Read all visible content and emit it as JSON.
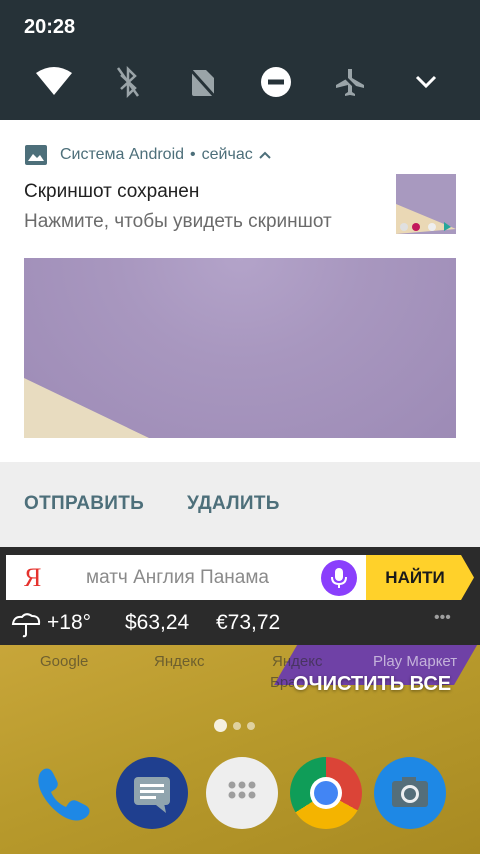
{
  "status": {
    "time": "20:28"
  },
  "quick_settings": {
    "tiles": [
      "wifi-icon",
      "bluetooth-off-icon",
      "no-sim-icon",
      "do-not-disturb-icon",
      "airplane-mode-off-icon",
      "expand-chevron-icon"
    ]
  },
  "notification": {
    "app_name": "Система Android",
    "separator": "•",
    "when": "сейчас",
    "title": "Скриншот сохранен",
    "text": "Нажмите, чтобы увидеть скриншот",
    "actions": {
      "share": "ОТПРАВИТЬ",
      "delete": "УДАЛИТЬ"
    }
  },
  "yandex": {
    "logo": "Я",
    "query": "матч Англия Панама",
    "search_button": "НАЙТИ"
  },
  "info": {
    "temperature": "+18°",
    "usd": "$63,24",
    "eur": "€73,72",
    "more": "•••"
  },
  "home": {
    "apps": [
      "Google",
      "Яндекс",
      "Яндекс",
      "Play Маркет"
    ],
    "partial_label": "Бра",
    "clear_all": "ОЧИСТИТЬ ВСЕ"
  },
  "colors": {
    "statusbar": "#263238",
    "accent": "#4d6f7a",
    "search_button": "#ffd12a",
    "mic": "#8a3ffc"
  }
}
